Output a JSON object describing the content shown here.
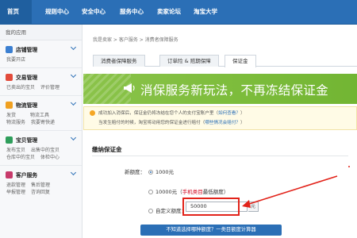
{
  "nav": {
    "items": [
      "首页",
      "规则中心",
      "安全中心",
      "服务中心",
      "卖家论坛",
      "淘宝大学"
    ]
  },
  "sidebar": {
    "header": "我的应用",
    "groups": [
      {
        "title": "店铺管理",
        "links": [
          "我要开店"
        ],
        "color": "#3b7fd1"
      },
      {
        "title": "交易管理",
        "links": [
          "已卖出的宝贝",
          "评价管理"
        ],
        "color": "#e24b3b"
      },
      {
        "title": "物流管理",
        "links": [
          "发货",
          "物流工具",
          "物流服务",
          "我要寄快递"
        ],
        "color": "#f0a020"
      },
      {
        "title": "宝贝管理",
        "links": [
          "发布宝贝",
          "出售中的宝贝",
          "仓库中的宝贝",
          "体检中心"
        ],
        "color": "#2e9e5b"
      },
      {
        "title": "客户服务",
        "links": [
          "退款管理",
          "售后管理",
          "举报管理",
          "咨询回复"
        ],
        "color": "#c73a6b"
      }
    ]
  },
  "breadcrumb": "我是卖家 > 客户服务 > 消费者保障服务",
  "tabs": [
    "消费者保障服务",
    "订单险 & 赔期保障",
    "保证金"
  ],
  "banner": {
    "text": "消保服务新玩法，不再冻结保证金"
  },
  "notice": {
    "line1_a": "成功加入消保后，保证金仍将冻结在您个人的支付宝账户里（",
    "line1_link": "如何查看？",
    "line1_b": "）",
    "line2_a": "当发生赔付的时候，淘宝将动用您的保证金进行赔付（",
    "line2_link": "哪些情况会赔付？",
    "line2_b": "）"
  },
  "deposit": {
    "title": "缴纳保证金",
    "new_amount_label": "新额度：",
    "option1": "1000元",
    "option2_value": "10000元",
    "option2_paren_open": "（",
    "option2_red": "手机类目",
    "option2_rest": "最低额度）",
    "option3": "自定义额度：",
    "custom_value": "50000",
    "unit": "元",
    "calc_button": "不知道选择哪种额度？一类目额度计算器"
  },
  "colors": {
    "nav": "#2b6fb6",
    "banner": "#7cbc3b",
    "highlight": "#e2231a"
  }
}
